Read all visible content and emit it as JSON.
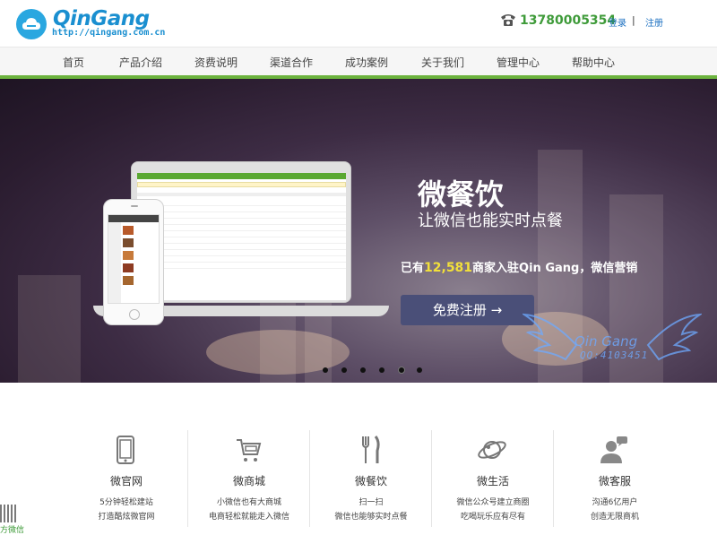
{
  "header": {
    "logo_name": "QinGang",
    "logo_url": "http://qingang.com.cn",
    "phone_number": "13780005354",
    "login_label": "登录",
    "separator": "|",
    "register_label": "注册"
  },
  "nav": {
    "items": [
      {
        "label": "首页"
      },
      {
        "label": "产品介绍"
      },
      {
        "label": "资费说明"
      },
      {
        "label": "渠道合作"
      },
      {
        "label": "成功案例"
      },
      {
        "label": "关于我们"
      },
      {
        "label": "管理中心"
      },
      {
        "label": "帮助中心"
      }
    ]
  },
  "banner": {
    "headline": "微餐饮",
    "subhead": "让微信也能实时点餐",
    "merchant_prefix": "已有",
    "merchant_count": "12,581",
    "merchant_suffix": "商家入驻Qin Gang，微信营销",
    "signup_button": "免费注册 →",
    "watermark_name": "Qin Gang",
    "watermark_qq": "QQ:4103451",
    "slides_total": 6,
    "active_slide": 4
  },
  "features": [
    {
      "icon": "mobile-site-icon",
      "title": "微官网",
      "line1": "5分钟轻松建站",
      "line2": "打造酷炫微官网"
    },
    {
      "icon": "shopping-cart-icon",
      "title": "微商城",
      "line1": "小微信也有大商城",
      "line2": "电商轻松就能走入微信"
    },
    {
      "icon": "fork-knife-icon",
      "title": "微餐饮",
      "line1": "扫一扫",
      "line2": "微信也能够实时点餐"
    },
    {
      "icon": "planet-icon",
      "title": "微生活",
      "line1": "微信公众号建立商圈",
      "line2": "吃喝玩乐应有尽有"
    },
    {
      "icon": "customer-service-icon",
      "title": "微客服",
      "line1": "沟通6亿用户",
      "line2": "创造无限商机"
    }
  ],
  "footer_widget": {
    "qr_label": "方微信"
  },
  "colors": {
    "brand_blue": "#1a8fd0",
    "brand_green": "#6cb33e",
    "phone_green": "#3f9b3a",
    "signup_button": "#4a4f78",
    "highlight_yellow": "#f2e03a"
  }
}
